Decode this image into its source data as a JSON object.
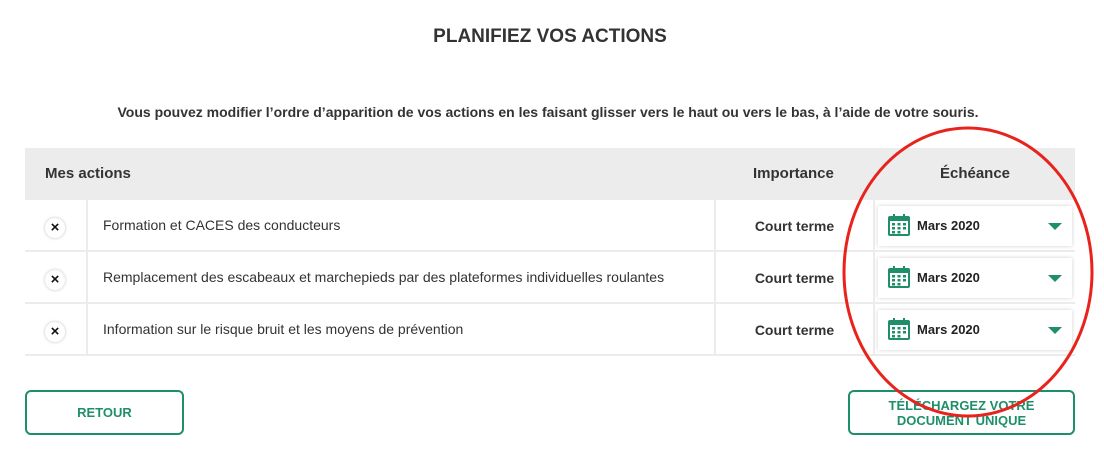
{
  "page": {
    "title": "PLANIFIEZ VOS ACTIONS",
    "instructions": "Vous pouvez modifier l’ordre d’apparition de vos actions en les faisant glisser vers le haut ou vers le bas, à l’aide de votre souris."
  },
  "table": {
    "headers": {
      "actions": "Mes actions",
      "importance": "Importance",
      "echeance": "Échéance"
    },
    "rows": [
      {
        "delete_icon": "×",
        "label": "Formation et CACES des conducteurs",
        "importance": "Court terme",
        "date": "Mars 2020"
      },
      {
        "delete_icon": "×",
        "label": "Remplacement des escabeaux et marchepieds par des plateformes individuelles roulantes",
        "importance": "Court terme",
        "date": "Mars 2020"
      },
      {
        "delete_icon": "×",
        "label": "Information sur le risque bruit et les moyens de prévention",
        "importance": "Court terme",
        "date": "Mars 2020"
      }
    ]
  },
  "buttons": {
    "back": "RETOUR",
    "download_line1": "TÉLÉCHARGEZ VOTRE",
    "download_line2": "DOCUMENT UNIQUE"
  },
  "icons": {
    "delete": "close-icon",
    "calendar": "calendar-icon",
    "dropdown": "chevron-down-icon"
  },
  "colors": {
    "accent": "#1e8f6a",
    "table_background": "#ececec",
    "annotation": "#e8231b"
  }
}
